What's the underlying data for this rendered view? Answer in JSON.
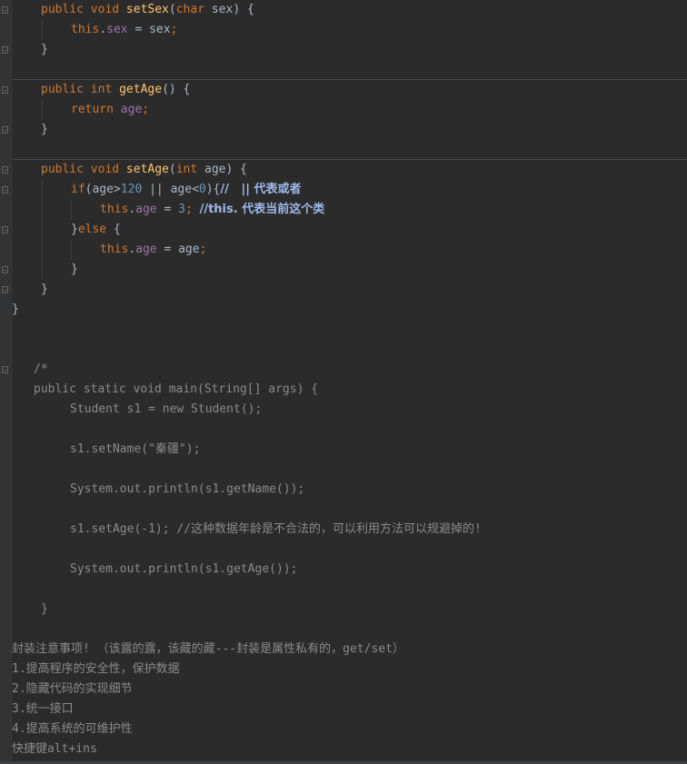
{
  "editor": {
    "set_sex": {
      "signature": {
        "mod": "public void ",
        "name": "setSex",
        "open": "(",
        "ptype": "char",
        "rest": " sex) {"
      },
      "body": {
        "this": "this",
        "dot": ".",
        "field": "sex",
        "rest": " = sex",
        "semi": ";"
      },
      "close": "}"
    },
    "get_age": {
      "signature": {
        "mod": "public int ",
        "name": "getAge",
        "rest": "() {"
      },
      "body": {
        "ret": "return ",
        "field": "age",
        "semi": ";"
      },
      "close": "}"
    },
    "set_age": {
      "signature": {
        "mod": "public void ",
        "name": "setAge",
        "open": "(",
        "ptype": "int",
        "rest": " age) {"
      },
      "if_line": {
        "kw": "if",
        "a": "(age>",
        "num": "120",
        "b": " || age<",
        "num2": "0",
        "c": "){",
        "comment": "//   || 代表或者"
      },
      "assign_line": {
        "this": "this",
        "dot": ".",
        "field": "age",
        "eq": " = ",
        "num": "3",
        "semi": "; ",
        "comment": "//this. 代表当前这个类"
      },
      "else_line": {
        "brace": "}",
        "kw": "else",
        "rest": " {"
      },
      "else_body": {
        "this": "this",
        "dot": ".",
        "field": "age",
        "rest": " = age",
        "semi": ";"
      },
      "inner_close": "}",
      "close": "}"
    },
    "class_close": "}"
  },
  "commented_block": {
    "open": "/*",
    "main_sig": "public static void main(String[] args) {",
    "student": "Student s1 = new Student();",
    "set_name": "s1.setName(\"秦疆\");",
    "print_name": "System.out.println(s1.getName());",
    "set_age": "s1.setAge(-1); //这种数据年龄是不合法的，可以利用方法可以规避掉的!",
    "print_age": "System.out.println(s1.getAge());",
    "close": "}"
  },
  "notes": {
    "title": "封装注意事项! （该露的露，该藏的藏---封装是属性私有的，get/set）",
    "items": [
      "1.提高程序的安全性，保护数据",
      "2.隐藏代码的实现细节",
      "3.统一接口",
      "4.提高系统的可维护性"
    ],
    "shortcut": "快捷键alt+ins"
  }
}
